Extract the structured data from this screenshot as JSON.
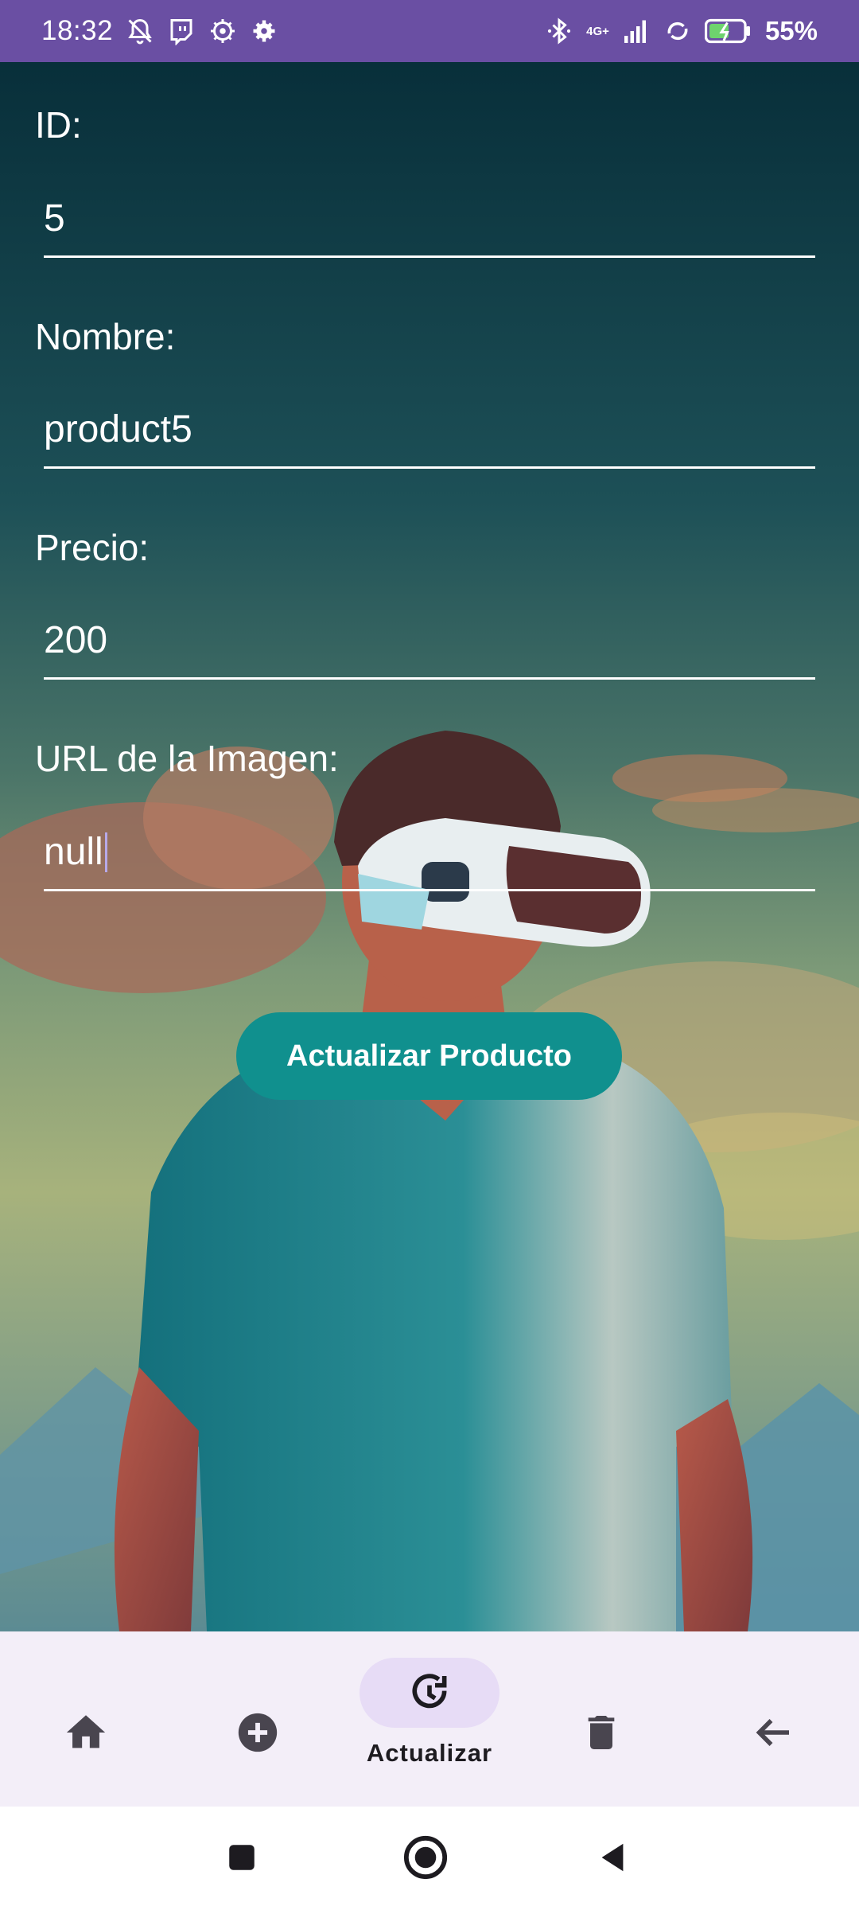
{
  "status_bar": {
    "time": "18:32",
    "battery": "55%",
    "network_top": "4G+",
    "icons_left": [
      "mute-icon",
      "twitch-icon",
      "settings-gear-icon",
      "settings-icon"
    ],
    "icons_right": [
      "bluetooth-icon",
      "signal-icon",
      "data-sync-icon",
      "battery-icon"
    ]
  },
  "form": {
    "id": {
      "label": "ID:",
      "value": "5"
    },
    "name": {
      "label": "Nombre:",
      "value": "product5"
    },
    "price": {
      "label": "Precio:",
      "value": "200"
    },
    "image_url": {
      "label": "URL de la Imagen:",
      "value": "null"
    },
    "submit_label": "Actualizar Producto"
  },
  "bottom_nav": {
    "items": [
      {
        "icon": "home-icon",
        "label": ""
      },
      {
        "icon": "add-circle-icon",
        "label": ""
      },
      {
        "icon": "update-icon",
        "label": "Actualizar",
        "active": true
      },
      {
        "icon": "delete-icon",
        "label": ""
      },
      {
        "icon": "arrow-back-icon",
        "label": ""
      }
    ]
  },
  "colors": {
    "status_bar": "#6a4fa3",
    "button": "#10908e",
    "nav_background": "#f3eef8",
    "nav_active_pill": "#e7dcf6"
  }
}
